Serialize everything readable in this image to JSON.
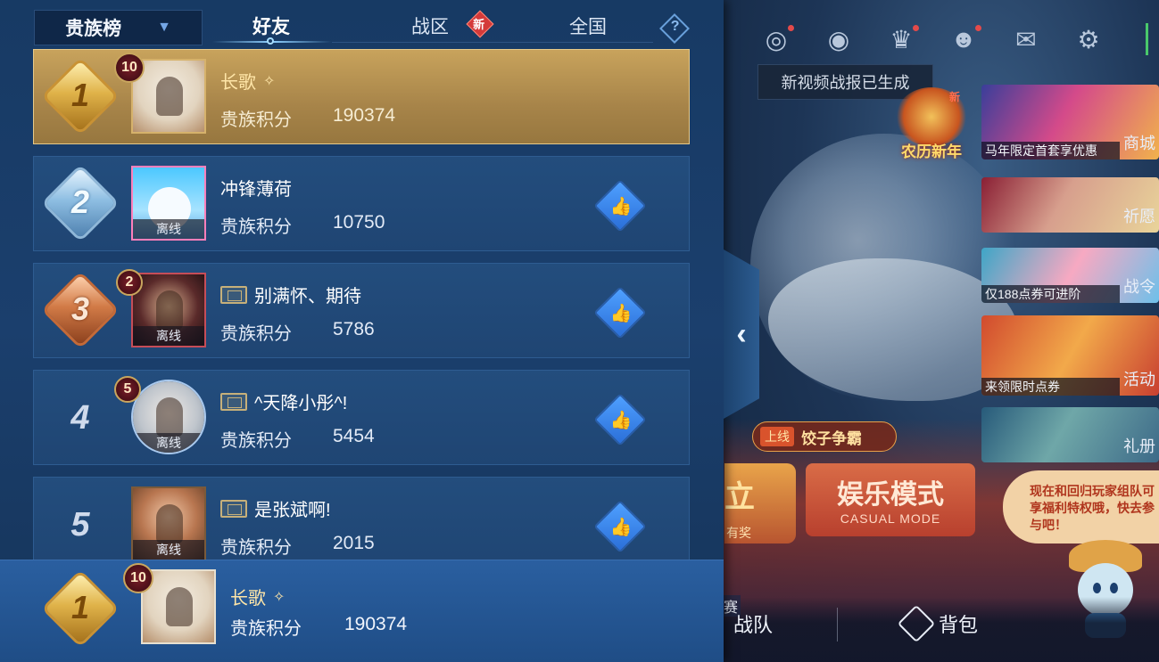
{
  "tabs": {
    "dropdown_label": "贵族榜",
    "friends": "好友",
    "zone": "战区",
    "national": "全国",
    "new_badge": "新",
    "help": "?"
  },
  "rows": [
    {
      "rank": "1",
      "name": "长歌",
      "name_symbol": "✧",
      "score_label": "贵族积分",
      "score": "190374",
      "level": "10",
      "status": ""
    },
    {
      "rank": "2",
      "name": "冲锋薄荷",
      "score_label": "贵族积分",
      "score": "10750",
      "status": "离线"
    },
    {
      "rank": "3",
      "name": "别满怀、期待",
      "score_label": "贵族积分",
      "score": "5786",
      "level": "2",
      "status": "离线"
    },
    {
      "rank": "4",
      "name": "^天降小彤^!",
      "score_label": "贵族积分",
      "score": "5454",
      "level": "5",
      "status": "离线"
    },
    {
      "rank": "5",
      "name": "是张斌啊!",
      "score_label": "贵族积分",
      "score": "2015",
      "status": "离线"
    }
  ],
  "self": {
    "rank": "1",
    "name": "长歌",
    "name_symbol": "✧",
    "level": "10",
    "score_label": "贵族积分",
    "score": "190374"
  },
  "icons": {
    "collapse": "chevron-left-icon",
    "like": "thumbs-up-icon",
    "top_bar": [
      "radar-icon",
      "eye-icon",
      "trophy-icon",
      "friends-icon",
      "mail-icon",
      "gear-icon"
    ]
  },
  "game": {
    "tooltip": "新视频战报已生成",
    "new_year_label": "农历新年",
    "new_year_new": "新",
    "cards": [
      {
        "caption": "马年限定首套享优惠",
        "side": "商城"
      },
      {
        "caption": "",
        "side": "祈愿"
      },
      {
        "caption": "仅188点券可进阶",
        "side": "战令"
      },
      {
        "caption": "来领限时点券",
        "side": "活动"
      },
      {
        "caption": "",
        "side": "礼册"
      }
    ],
    "online_tag": "上线",
    "online_text": "饺子争霸",
    "casual_cn": "娱乐模式",
    "casual_en": "CASUAL MODE",
    "left_peek_big": "立",
    "left_peek_small": "有奖",
    "promo": "现在和回归玩家组队可享福利特权哦，快去参与吧！",
    "match_label": "赛",
    "nav_team": "战队",
    "nav_bag": "背包"
  },
  "colors": {
    "panel": "#173a64",
    "self_row": "#c8a35c",
    "accent_blue": "#3a86ff",
    "gold": "#e0b34a"
  }
}
